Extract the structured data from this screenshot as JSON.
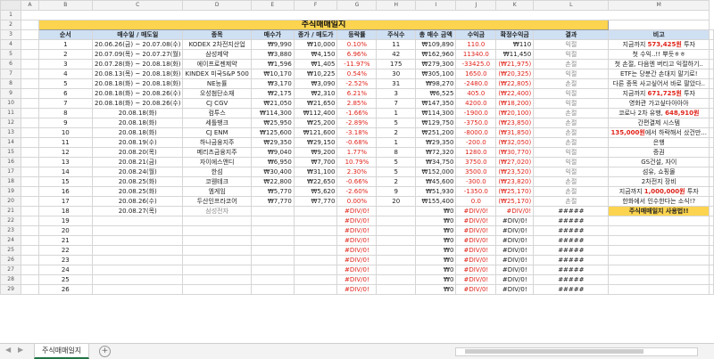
{
  "title": "주식매매일지",
  "columns": [
    "A",
    "B",
    "C",
    "D",
    "E",
    "F",
    "G",
    "H",
    "I",
    "J",
    "K",
    "L",
    "M"
  ],
  "headers": [
    "순서",
    "매수일 / 매도일",
    "종목",
    "매수가",
    "종가 / 매도가",
    "등락률",
    "주식수",
    "총 매수 금액",
    "수익금",
    "확정수익금",
    "결과",
    "비고"
  ],
  "rows": [
    {
      "n": "1",
      "date": "20.06.26(금) ~ 20.07.08(수)",
      "name": "KODEX 2차전지산업",
      "buy": "₩9,990",
      "sell": "₩10,000",
      "rate": "0.10%",
      "qty": "11",
      "total": "₩109,890",
      "profit": "110.0",
      "fixed": "₩110",
      "res": "익절",
      "note": "지금까지 573,425원 투자",
      "rc": "red",
      "pc": "red",
      "fc": "",
      "resc": "gray"
    },
    {
      "n": "2",
      "date": "20.07.09(목) ~ 20.07.27(월)",
      "name": "삼성제약",
      "buy": "₩3,880",
      "sell": "₩4,150",
      "rate": "6.96%",
      "qty": "42",
      "total": "₩162,960",
      "profit": "11340.0",
      "fixed": "₩11,450",
      "res": "익절",
      "note": "첫 수익..!! 뿌듯ㅎㅎ",
      "rc": "red",
      "pc": "red",
      "fc": "",
      "resc": "gray"
    },
    {
      "n": "3",
      "date": "20.07.28(화) ~ 20.08.18(화)",
      "name": "에이프로젠제약",
      "buy": "₩1,596",
      "sell": "₩1,405",
      "rate": "-11.97%",
      "qty": "175",
      "total": "₩279,300",
      "profit": "-33425.0",
      "fixed": "(₩21,975)",
      "res": "손절",
      "note": "첫 손절, 다음엔 버티고 익절하기..",
      "rc": "red",
      "pc": "red",
      "fc": "red",
      "resc": "gray"
    },
    {
      "n": "4",
      "date": "20.08.13(목) ~ 20.08.18(화)",
      "name": "KINDEX 미국S&P 500",
      "buy": "₩10,170",
      "sell": "₩10,225",
      "rate": "0.54%",
      "qty": "30",
      "total": "₩305,100",
      "profit": "1650.0",
      "fixed": "(₩20,325)",
      "res": "익절",
      "note": "ETF는 당분간 손대지 말기로!",
      "rc": "red",
      "pc": "red",
      "fc": "red",
      "resc": "gray"
    },
    {
      "n": "5",
      "date": "20.08.18(화) ~ 20.08.18(화)",
      "name": "NE능률",
      "buy": "₩3,170",
      "sell": "₩3,090",
      "rate": "-2.52%",
      "qty": "31",
      "total": "₩98,270",
      "profit": "-2480.0",
      "fixed": "(₩22,805)",
      "res": "손절",
      "note": "다른 종목 사고싶어서 바로 팔았다..",
      "rc": "red",
      "pc": "red",
      "fc": "red",
      "resc": "gray"
    },
    {
      "n": "6",
      "date": "20.08.18(화) ~ 20.08.26(수)",
      "name": "오성첨단소재",
      "buy": "₩2,175",
      "sell": "₩2,310",
      "rate": "6.21%",
      "qty": "3",
      "total": "₩6,525",
      "profit": "405.0",
      "fixed": "(₩22,400)",
      "res": "익절",
      "note": "지금까지 671,725원 투자",
      "rc": "red",
      "pc": "red",
      "fc": "red",
      "resc": "gray"
    },
    {
      "n": "7",
      "date": "20.08.18(화) ~ 20.08.26(수)",
      "name": "CJ CGV",
      "buy": "₩21,050",
      "sell": "₩21,650",
      "rate": "2.85%",
      "qty": "7",
      "total": "₩147,350",
      "profit": "4200.0",
      "fixed": "(₩18,200)",
      "res": "익절",
      "note": "영화관 가고싶다아아아",
      "rc": "red",
      "pc": "red",
      "fc": "red",
      "resc": "gray"
    },
    {
      "n": "8",
      "date": "20.08.18(화)",
      "name": "컴투스",
      "buy": "₩114,300",
      "sell": "₩112,400",
      "rate": "-1.66%",
      "qty": "1",
      "total": "₩114,300",
      "profit": "-1900.0",
      "fixed": "(₩20,100)",
      "res": "손절",
      "note": "코로나 2차 유행, 648,910원",
      "rc": "red",
      "pc": "red",
      "fc": "red",
      "resc": "gray"
    },
    {
      "n": "9",
      "date": "20.08.18(화)",
      "name": "세틀뱅크",
      "buy": "₩25,950",
      "sell": "₩25,200",
      "rate": "-2.89%",
      "qty": "5",
      "total": "₩129,750",
      "profit": "-3750.0",
      "fixed": "(₩23,850)",
      "res": "손절",
      "note": "간편결제 시스템",
      "rc": "red",
      "pc": "red",
      "fc": "red",
      "resc": "gray"
    },
    {
      "n": "10",
      "date": "20.08.18(화)",
      "name": "CJ ENM",
      "buy": "₩125,600",
      "sell": "₩121,600",
      "rate": "-3.18%",
      "qty": "2",
      "total": "₩251,200",
      "profit": "-8000.0",
      "fixed": "(₩31,850)",
      "res": "손절",
      "note": "135,000원에서 하락해서 샀건만...",
      "rc": "red",
      "pc": "red",
      "fc": "red",
      "resc": "gray"
    },
    {
      "n": "11",
      "date": "20.08.19(수)",
      "name": "하나금융지주",
      "buy": "₩29,350",
      "sell": "₩29,150",
      "rate": "-0.68%",
      "qty": "1",
      "total": "₩29,350",
      "profit": "-200.0",
      "fixed": "(₩32,050)",
      "res": "손절",
      "note": "은행",
      "rc": "red",
      "pc": "red",
      "fc": "red",
      "resc": "gray"
    },
    {
      "n": "12",
      "date": "20.08.20(목)",
      "name": "메리츠금융지주",
      "buy": "₩9,040",
      "sell": "₩9,200",
      "rate": "1.77%",
      "qty": "8",
      "total": "₩72,320",
      "profit": "1280.0",
      "fixed": "(₩30,770)",
      "res": "익절",
      "note": "증권",
      "rc": "red",
      "pc": "red",
      "fc": "red",
      "resc": "gray"
    },
    {
      "n": "13",
      "date": "20.08.21(금)",
      "name": "자이에스앤디",
      "buy": "₩6,950",
      "sell": "₩7,700",
      "rate": "10.79%",
      "qty": "5",
      "total": "₩34,750",
      "profit": "3750.0",
      "fixed": "(₩27,020)",
      "res": "익절",
      "note": "GS건설, 자이",
      "rc": "red",
      "pc": "red",
      "fc": "red",
      "resc": "gray"
    },
    {
      "n": "14",
      "date": "20.08.24(월)",
      "name": "한섬",
      "buy": "₩30,400",
      "sell": "₩31,100",
      "rate": "2.30%",
      "qty": "5",
      "total": "₩152,000",
      "profit": "3500.0",
      "fixed": "(₩23,520)",
      "res": "익절",
      "note": "섬유, 쇼핑몰",
      "rc": "red",
      "pc": "red",
      "fc": "red",
      "resc": "gray"
    },
    {
      "n": "15",
      "date": "20.08.25(화)",
      "name": "코웬테크",
      "buy": "₩22,800",
      "sell": "₩22,650",
      "rate": "-0.66%",
      "qty": "2",
      "total": "₩45,600",
      "profit": "-300.0",
      "fixed": "(₩23,820)",
      "res": "손절",
      "note": "2차전지 장비",
      "rc": "red",
      "pc": "red",
      "fc": "red",
      "resc": "gray"
    },
    {
      "n": "16",
      "date": "20.08.25(화)",
      "name": "엠게임",
      "buy": "₩5,770",
      "sell": "₩5,620",
      "rate": "-2.60%",
      "qty": "9",
      "total": "₩51,930",
      "profit": "-1350.0",
      "fixed": "(₩25,170)",
      "res": "손절",
      "note": "지금까지 1,000,000원 투자",
      "rc": "red",
      "pc": "red",
      "fc": "red",
      "resc": "gray"
    },
    {
      "n": "17",
      "date": "20.08.26(수)",
      "name": "두산인프라코어",
      "buy": "₩7,770",
      "sell": "₩7,770",
      "rate": "0.00%",
      "qty": "20",
      "total": "₩155,400",
      "profit": "0.0",
      "fixed": "(₩25,170)",
      "res": "손절",
      "note": "한화에서 인수한다는 소식!?",
      "rc": "red",
      "pc": "red",
      "fc": "red",
      "resc": "gray"
    },
    {
      "n": "18",
      "date": "20.08.27(목)",
      "name": "삼성전자",
      "buy": "",
      "sell": "",
      "rate": "#DIV/0!",
      "qty": "",
      "total": "₩0",
      "profit": "#DIV/0!",
      "fixed": "#DIV/0!",
      "res": "#####",
      "note": "주식매매일지 사용법!!",
      "rc": "red",
      "pc": "red",
      "fc": "",
      "resc": ""
    }
  ],
  "empty_rows": [
    "19",
    "20",
    "21",
    "22",
    "23",
    "24",
    "25",
    "26"
  ],
  "err": {
    "div": "#DIV/0!",
    "zero": "₩0",
    "hash": "#####"
  },
  "sheet_tab": "주식매매일지",
  "add_sheet": "+"
}
